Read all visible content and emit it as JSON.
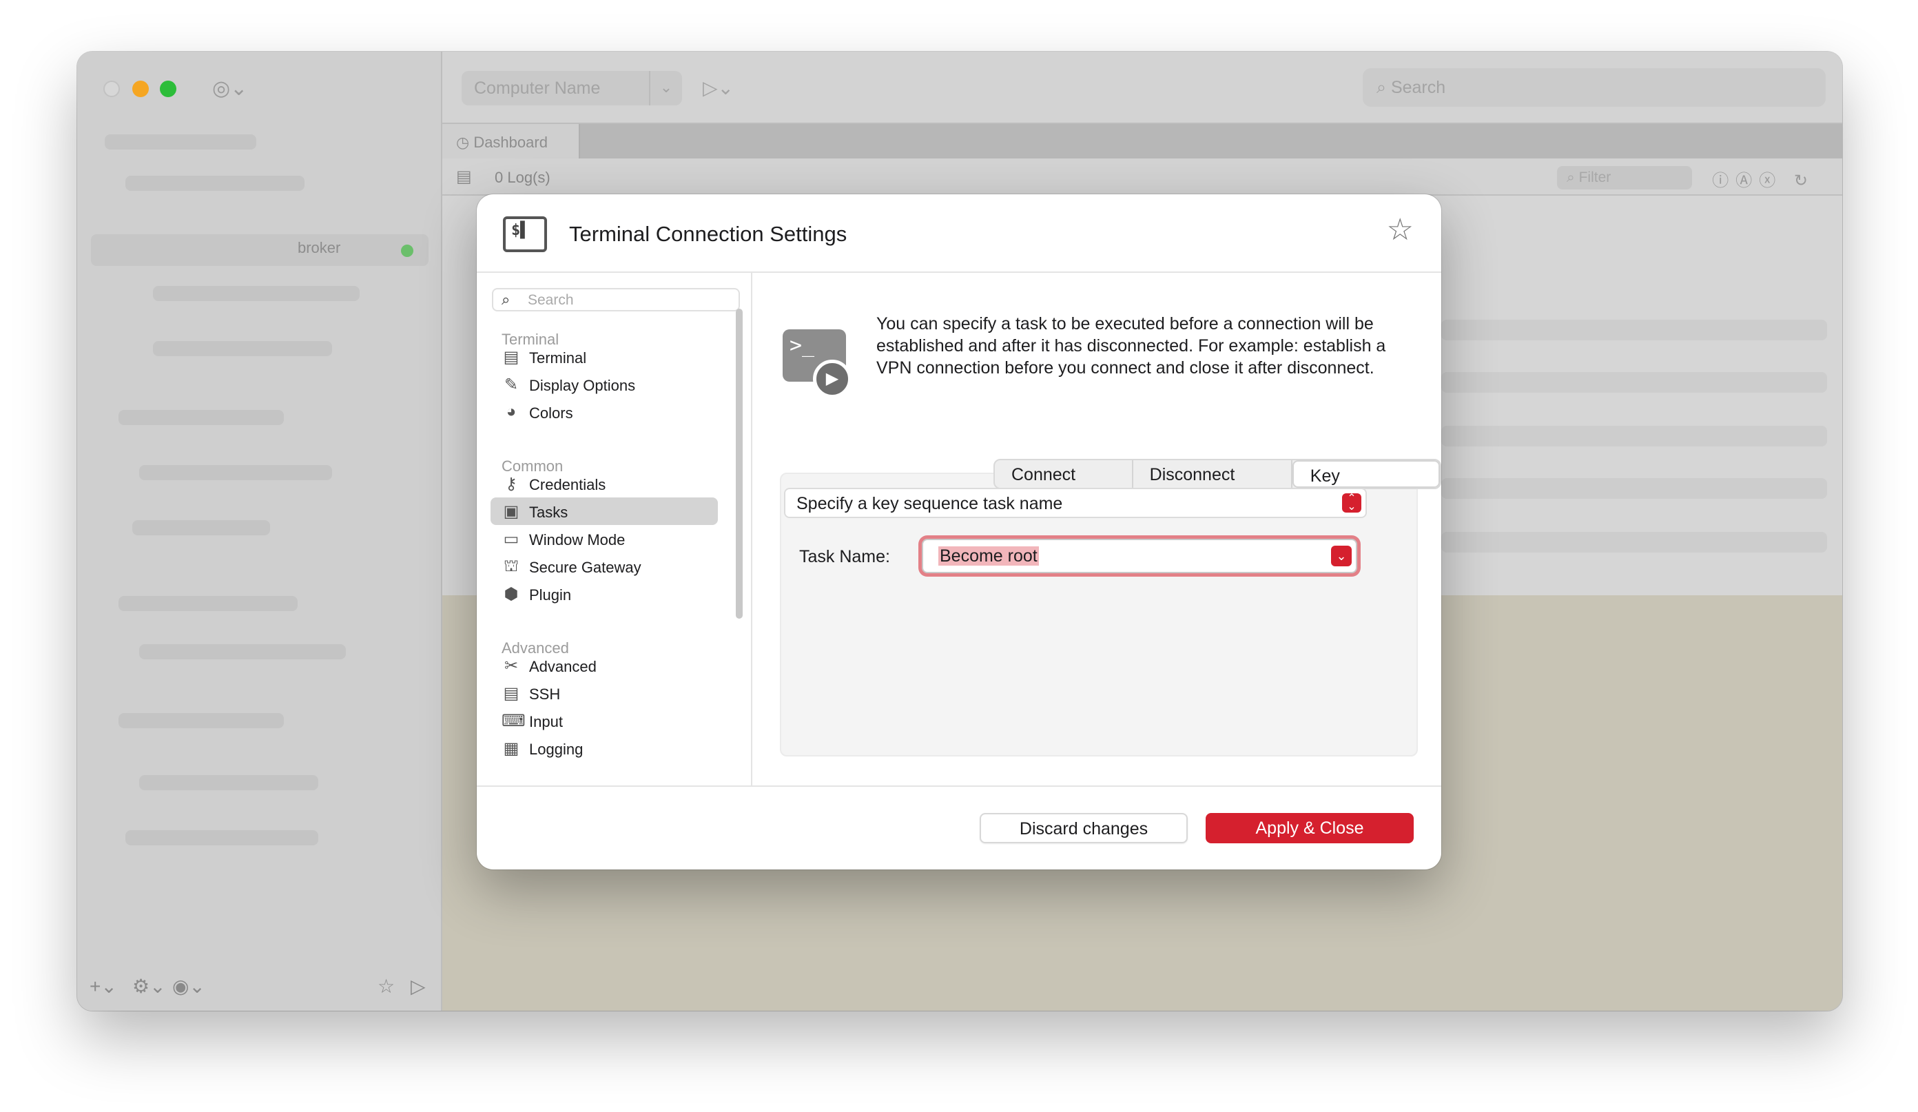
{
  "app": {
    "sidebar": {
      "selected_label": "broker",
      "bottom_icons": [
        "plus-icon",
        "gear-icon",
        "globe-icon",
        "star-icon",
        "play-icon"
      ]
    },
    "toolbar": {
      "computer_name_placeholder": "Computer Name",
      "search_placeholder": "Search"
    },
    "tabs": [
      {
        "label": "Dashboard"
      }
    ],
    "log": {
      "count_label": "0 Log(s)",
      "filter_placeholder": "Filter"
    }
  },
  "dialog": {
    "title": "Terminal Connection Settings",
    "search_placeholder": "Search",
    "sections": [
      {
        "header": "Terminal",
        "items": [
          {
            "label": "Terminal",
            "icon": "terminal-icon"
          },
          {
            "label": "Display Options",
            "icon": "brush-icon"
          },
          {
            "label": "Colors",
            "icon": "palette-icon"
          }
        ]
      },
      {
        "header": "Common",
        "items": [
          {
            "label": "Credentials",
            "icon": "key-icon"
          },
          {
            "label": "Tasks",
            "icon": "tasks-icon",
            "selected": true
          },
          {
            "label": "Window Mode",
            "icon": "window-icon"
          },
          {
            "label": "Secure Gateway",
            "icon": "gateway-icon"
          },
          {
            "label": "Plugin",
            "icon": "plugin-icon"
          }
        ]
      },
      {
        "header": "Advanced",
        "items": [
          {
            "label": "Advanced",
            "icon": "tools-icon"
          },
          {
            "label": "SSH",
            "icon": "ssh-icon"
          },
          {
            "label": "Input",
            "icon": "keyboard-icon"
          },
          {
            "label": "Logging",
            "icon": "logging-icon"
          }
        ]
      }
    ],
    "description": "You can specify a task to be executed before a connection will be established and after it has disconnected. For example: establish a VPN connection before you connect and close it after disconnect.",
    "segments": [
      "Connect Task",
      "Disconnect Task",
      "Key Sequence"
    ],
    "active_segment": "Key Sequence",
    "key_sequence_select": "Specify a key sequence task name",
    "task_name_label": "Task Name:",
    "task_name_value": "Become root",
    "buttons": {
      "discard": "Discard changes",
      "apply": "Apply & Close"
    },
    "colors": {
      "accent": "#d5202e",
      "selection_highlight": "#f2b6bb"
    }
  }
}
